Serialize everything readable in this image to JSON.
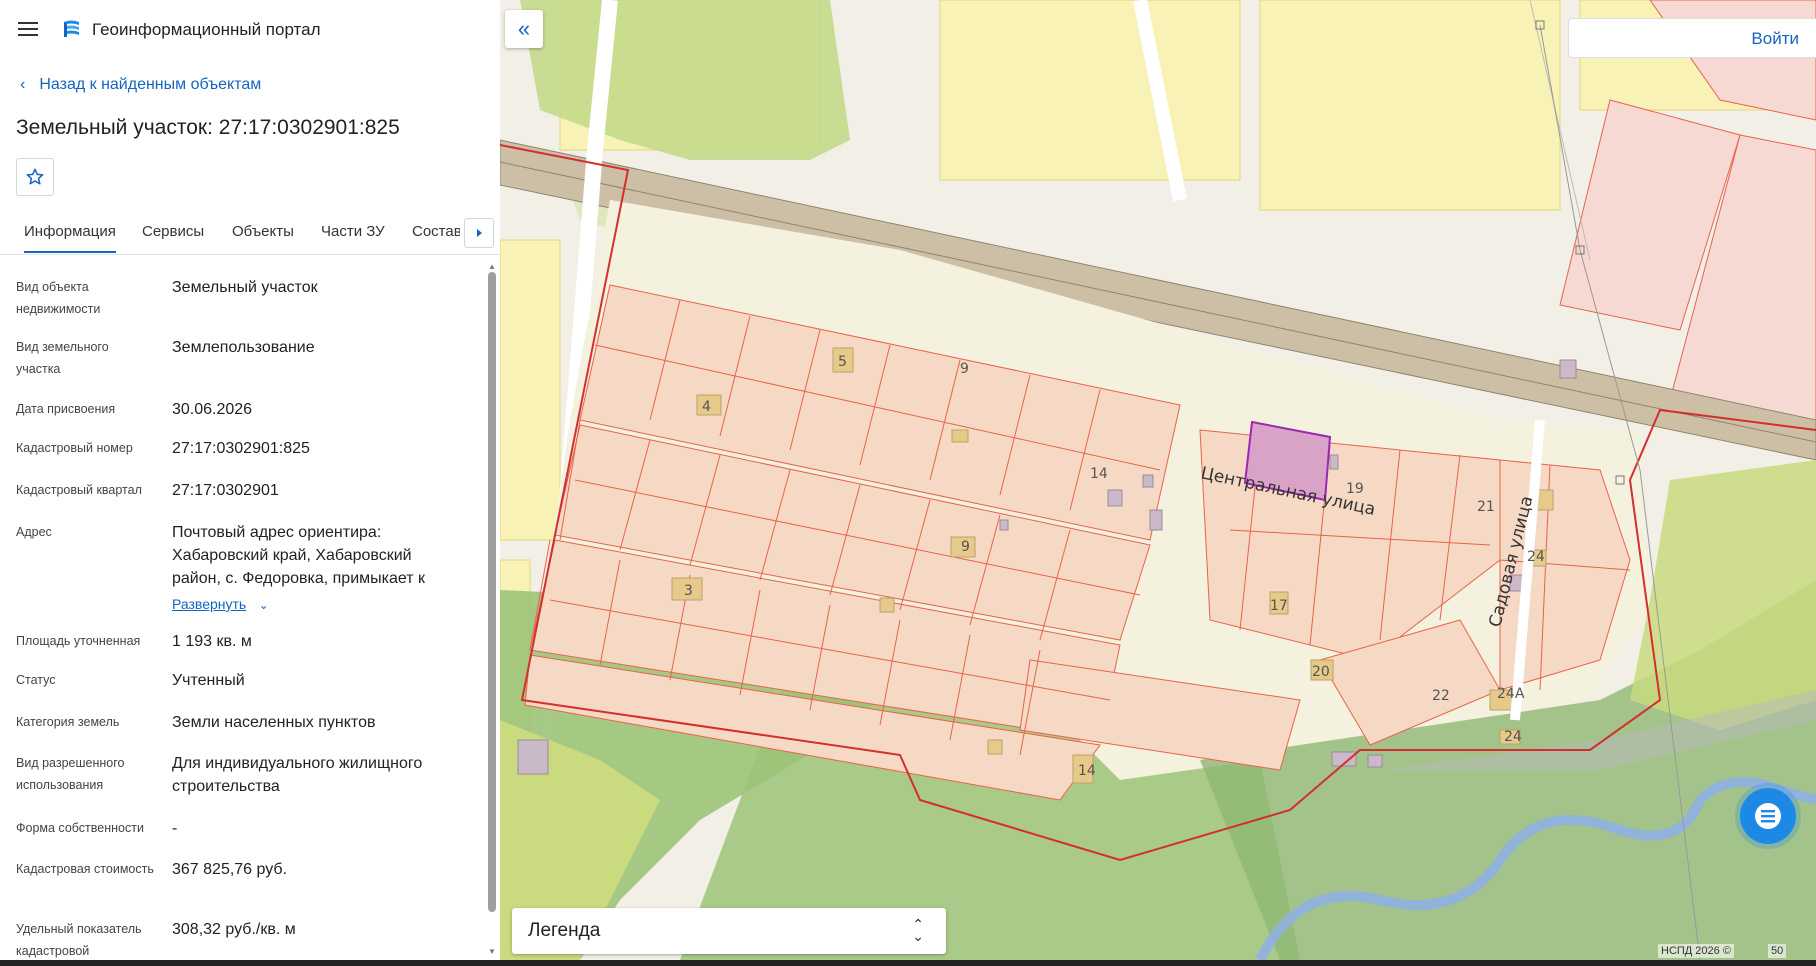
{
  "header": {
    "app_title": "Геоинформационный портал"
  },
  "back_link": "Назад к найденным объектам",
  "object_title": "Земельный участок: 27:17:0302901:825",
  "tabs": [
    {
      "label": "Информация"
    },
    {
      "label": "Сервисы"
    },
    {
      "label": "Объекты"
    },
    {
      "label": "Части ЗУ"
    },
    {
      "label": "Состав"
    }
  ],
  "properties": [
    {
      "label": "Вид объекта недвижимости",
      "value": "Земельный участок"
    },
    {
      "label": "Вид земельного участка",
      "value": "Землепользование"
    },
    {
      "label": "Дата присвоения",
      "value": "30.06.2026"
    },
    {
      "label": "Кадастровый номер",
      "value": "27:17:0302901:825"
    },
    {
      "label": "Кадастровый квартал",
      "value": "27:17:0302901"
    },
    {
      "label": "Адрес",
      "value": "Почтовый адрес ориентира: Хабаровский край, Хабаровский район, с. Федоровка, примыкает к",
      "expand": "Развернуть"
    },
    {
      "label": "Площадь уточненная",
      "value": "1 193 кв. м"
    },
    {
      "label": "Статус",
      "value": "Учтенный"
    },
    {
      "label": "Категория земель",
      "value": "Земли населенных пунктов"
    },
    {
      "label": "Вид разрешенного использования",
      "value": "Для индивидуального жилищного строительства"
    },
    {
      "label": "Форма собственности",
      "value": "-"
    },
    {
      "label": "Кадастровая стоимость",
      "value": "367 825,76 руб."
    },
    {
      "label": "Удельный показатель кадастровой",
      "value": "308,32 руб./кв. м"
    }
  ],
  "map": {
    "login_label": "Войти",
    "legend_label": "Легенда",
    "copyright": "НСПД 2026 ©",
    "scale": "50",
    "street_labels": {
      "central": "Центральная улица",
      "sadovaya": "Садовая улица"
    },
    "house_numbers": [
      "5",
      "9",
      "4",
      "14",
      "19",
      "21",
      "9",
      "24",
      "3",
      "17",
      "20",
      "22",
      "24А",
      "24",
      "14"
    ]
  },
  "colors": {
    "accent": "#1565c0",
    "parcel_fill": "#f6d9c4",
    "parcel_line": "#e8634a",
    "boundary": "#d32f2f",
    "selected": "#9c27b0"
  }
}
